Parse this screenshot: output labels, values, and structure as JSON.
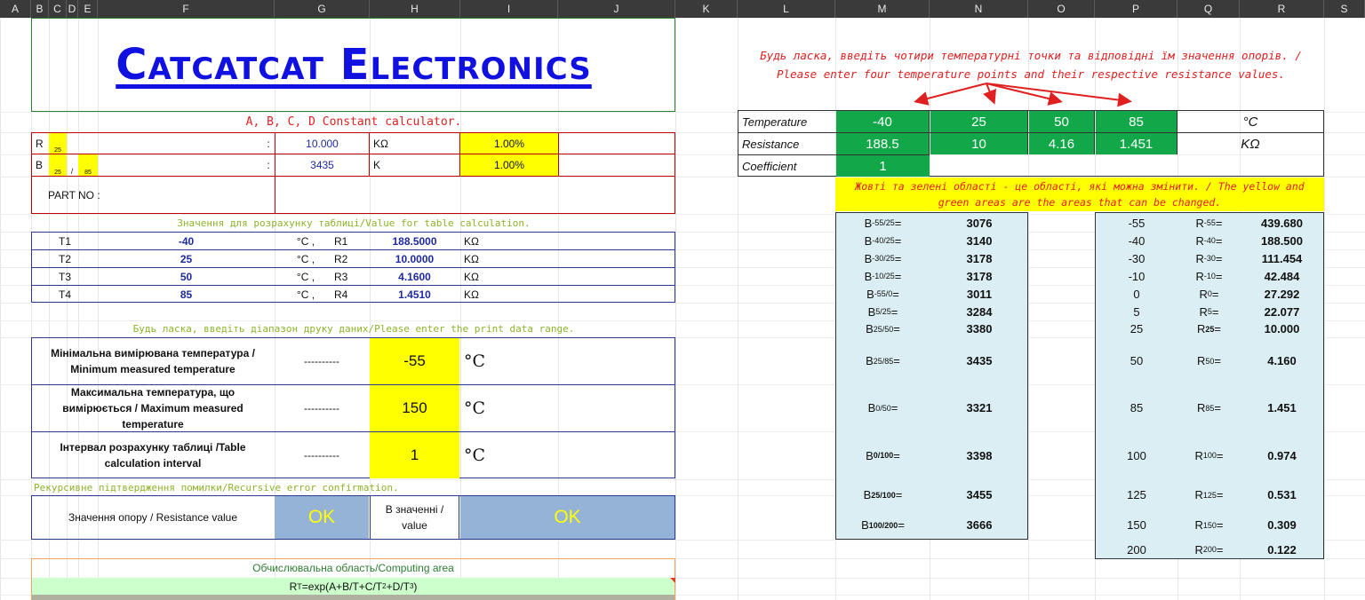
{
  "columns": [
    "A",
    "B",
    "C",
    "D",
    "E",
    "F",
    "G",
    "H",
    "I",
    "J",
    "K",
    "L",
    "M",
    "N",
    "O",
    "P",
    "Q",
    "R",
    "S"
  ],
  "colors": {
    "accent_navy": "#1e2a9e",
    "label_red": "#e02020",
    "label_olive": "#8db32a",
    "green": "#12a84a",
    "yellow": "#ffff00",
    "light_blue": "#dbeef3",
    "ok_blue": "#95b3d7",
    "compute_green": "#ccffcc",
    "compute_border": "#f4a460"
  },
  "company": {
    "name": "Catcatcat Electronics"
  },
  "calc": {
    "title": "A, B, C, D Constant calculator.",
    "r_label": "R",
    "r_sub": "25",
    "colon": ":",
    "r_value": "10.000",
    "r_unit": "KΩ",
    "r_tol": "1.00%",
    "b_label": "B",
    "b_sub1": "25",
    "b_slash": "/",
    "b_sub2": "85",
    "b_value": "3435",
    "b_unit": "K",
    "b_tol": "1.00%",
    "part_no": "PART NO :"
  },
  "table_values": {
    "title": "Значення для розрахунку таблиці/Value for table calculation.",
    "rows": [
      {
        "t": "T1",
        "tv": "-40",
        "r": "R1",
        "rv": "188.5000"
      },
      {
        "t": "T2",
        "tv": "25",
        "r": "R2",
        "rv": "10.0000"
      },
      {
        "t": "T3",
        "tv": "50",
        "r": "R3",
        "rv": "4.1600"
      },
      {
        "t": "T4",
        "tv": "85",
        "r": "R4",
        "rv": "1.4510"
      }
    ],
    "deg_unit": "°C   ,",
    "res_unit": "KΩ"
  },
  "print_range": {
    "title": "Будь ласка, введіть діапазон друку даних/Please enter the print data range.",
    "rows": [
      {
        "label": "Мінімальна вимірювана температура / Minimum measured temperature",
        "dash": "----------",
        "value": "-55",
        "unit": "°C"
      },
      {
        "label": "Максимальна температура, що вимірюється / Maximum measured temperature",
        "dash": "----------",
        "value": "150",
        "unit": "°C"
      },
      {
        "label": "Інтервал розрахунку таблиці /Table calculation interval",
        "dash": "----------",
        "value": "1",
        "unit": "°C"
      }
    ]
  },
  "recursive": {
    "title": "Рекурсивне підтвердження помилки/Recursive error confirmation.",
    "resistance_label": "Значення опору / Resistance value",
    "ok1": "OK",
    "in_value_label": "В значенні / value",
    "ok2": "OK"
  },
  "computing": {
    "title": "Обчислювальна область/Computing area",
    "formula_main": "R",
    "formula_sub": "T",
    "formula_mid": "=exp(A+B/T+C/T",
    "formula_sup1": "2",
    "formula_mid2": "+D/T",
    "formula_sup2": "3",
    "formula_end": ")"
  },
  "instructions": {
    "line1": "Будь ласка, введіть чотири температурні точки та відповідні їм значення опорів. /",
    "line2": "Please enter four temperature points and their respective resistance values."
  },
  "temp_table": {
    "temp_label": "Temperature",
    "res_label": "Resistance",
    "coef_label": "Coefficient",
    "temps": [
      "-40",
      "25",
      "50",
      "85"
    ],
    "resistances": [
      "188.5",
      "10",
      "4.16",
      "1.451"
    ],
    "coefficient": "1",
    "temp_unit": "°C",
    "res_unit": "KΩ"
  },
  "note": "Жовті та зелені області - це області, які можна змінити. / The yellow and green areas are the areas that can be changed.",
  "b_values": [
    {
      "label": "B",
      "sub": "-55/25",
      "suffix": "=",
      "value": "3076"
    },
    {
      "label": "B",
      "sub": "-40/25",
      "suffix": "=",
      "value": "3140"
    },
    {
      "label": "B",
      "sub": "-30/25",
      "suffix": "=",
      "value": "3178"
    },
    {
      "label": "B",
      "sub": "-10/25",
      "suffix": "=",
      "value": "3178"
    },
    {
      "label": "B",
      "sub": "-55/0",
      "suffix": "=",
      "value": "3011"
    },
    {
      "label": "B",
      "sub": "5/25",
      "suffix": "=",
      "value": "3284"
    },
    {
      "label": "B",
      "sub": "25/50",
      "suffix": "=",
      "value": "3380"
    },
    {
      "label": "B",
      "sub": "25/85",
      "suffix": "=",
      "value": "3435"
    },
    {
      "label": "B",
      "sub": "0/50",
      "suffix": "=",
      "value": "3321"
    },
    {
      "label": "B",
      "sub": "0/100",
      "suffix": "=",
      "value": "3398"
    },
    {
      "label": "B",
      "sub": "25/100",
      "suffix": "=",
      "value": "3455"
    },
    {
      "label": "B",
      "sub": "100/200",
      "suffix": "=",
      "value": "3666"
    }
  ],
  "r_values": [
    {
      "t": "-55",
      "label": "R",
      "sub": "-55",
      "suffix": "=",
      "value": "439.680"
    },
    {
      "t": "-40",
      "label": "R",
      "sub": "-40",
      "suffix": "=",
      "value": "188.500"
    },
    {
      "t": "-30",
      "label": "R",
      "sub": "-30",
      "suffix": "=",
      "value": "111.454"
    },
    {
      "t": "-10",
      "label": "R",
      "sub": "-10",
      "suffix": "=",
      "value": "42.484"
    },
    {
      "t": "0",
      "label": "R",
      "sub": "0",
      "suffix": "=",
      "value": "27.292"
    },
    {
      "t": "5",
      "label": "R",
      "sub": "5",
      "suffix": "=",
      "value": "22.077"
    },
    {
      "t": "25",
      "label": "R",
      "sub": "25",
      "suffix": "=",
      "value": "10.000"
    },
    {
      "t": "50",
      "label": "R",
      "sub": "50",
      "suffix": "=",
      "value": "4.160"
    },
    {
      "t": "85",
      "label": "R",
      "sub": "85",
      "suffix": "=",
      "value": "1.451"
    },
    {
      "t": "100",
      "label": "R",
      "sub": "100",
      "suffix": "=",
      "value": "0.974"
    },
    {
      "t": "125",
      "label": "R",
      "sub": "125",
      "suffix": "=",
      "value": "0.531"
    },
    {
      "t": "150",
      "label": "R",
      "sub": "150",
      "suffix": "=",
      "value": "0.309"
    },
    {
      "t": "200",
      "label": "R",
      "sub": "200",
      "suffix": "=",
      "value": "0.122"
    }
  ]
}
